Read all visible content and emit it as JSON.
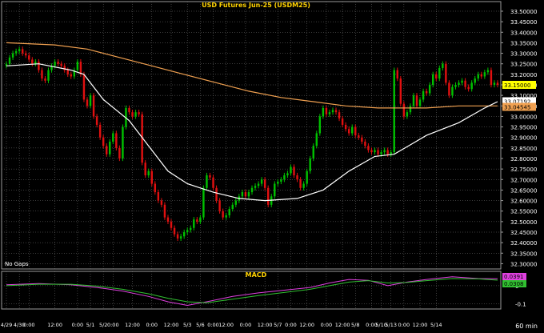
{
  "colors": {
    "background": "#000000",
    "grid": "#7a7a7a",
    "border": "#9a9a9a",
    "title": "#ffd200",
    "text": "#ffffff",
    "candle_up": "#00c000",
    "candle_down": "#e01010",
    "ma_short": "#ffffff",
    "ma_long": "#f0a050",
    "macd_line": "#e040e0",
    "signal_line": "#30c030",
    "last_price_tag": "#ffff00",
    "ma_short_tag": "#ffffff",
    "ma_long_tag": "#f0a050"
  },
  "chart_data": [
    {
      "type": "candlestick",
      "title": "USD Futures Jun-25 (USDM25)",
      "note": "No Gaps",
      "ylim": [
        32.275,
        33.5
      ],
      "y_ticks": [
        "33.50000",
        "33.45000",
        "33.40000",
        "33.35000",
        "33.30000",
        "33.25000",
        "33.20000",
        "33.15000",
        "33.10000",
        "33.05000",
        "33.00000",
        "32.95000",
        "32.90000",
        "32.85000",
        "32.80000",
        "32.75000",
        "32.70000",
        "32.65000",
        "32.60000",
        "32.55000",
        "32.50000",
        "32.45000",
        "32.40000",
        "32.35000",
        "32.30000"
      ],
      "price_tags": {
        "last": "33.15000",
        "ma_short": "33.07192",
        "ma_long": "33.04545"
      },
      "tag_values": {
        "last": 33.15,
        "ma_short": 33.07192,
        "ma_long": 33.04545
      },
      "bar_count": 153,
      "closes": [
        33.25,
        33.28,
        33.3,
        33.31,
        33.32,
        33.3,
        33.29,
        33.27,
        33.25,
        33.26,
        33.22,
        33.18,
        33.17,
        33.22,
        33.24,
        33.26,
        33.25,
        33.24,
        33.22,
        33.2,
        33.19,
        33.22,
        33.26,
        33.2,
        33.08,
        33.05,
        33.1,
        33.0,
        32.96,
        32.9,
        32.86,
        32.82,
        32.88,
        32.92,
        32.85,
        32.8,
        32.95,
        33.04,
        33.02,
        33.0,
        33.02,
        33.01,
        32.78,
        32.72,
        32.74,
        32.68,
        32.64,
        32.6,
        32.58,
        32.52,
        32.5,
        32.47,
        32.44,
        32.42,
        32.43,
        32.45,
        32.46,
        32.47,
        32.51,
        32.5,
        32.52,
        32.66,
        32.72,
        32.71,
        32.66,
        32.6,
        32.55,
        32.52,
        32.53,
        32.56,
        32.58,
        32.6,
        32.62,
        32.64,
        32.62,
        32.64,
        32.66,
        32.67,
        32.68,
        32.7,
        32.66,
        32.58,
        32.62,
        32.68,
        32.69,
        32.7,
        32.72,
        32.73,
        32.76,
        32.72,
        32.7,
        32.66,
        32.68,
        32.74,
        32.8,
        32.86,
        32.92,
        33.0,
        33.04,
        33.01,
        33.02,
        33.03,
        33.02,
        32.99,
        32.96,
        32.94,
        32.92,
        32.95,
        32.91,
        32.9,
        32.88,
        32.86,
        32.84,
        32.83,
        32.84,
        32.82,
        32.83,
        32.84,
        32.82,
        32.83,
        33.22,
        33.18,
        33.06,
        33.0,
        33.02,
        33.05,
        33.1,
        33.05,
        33.08,
        33.12,
        33.11,
        33.15,
        33.2,
        33.18,
        33.23,
        33.25,
        33.16,
        33.1,
        33.14,
        33.15,
        33.16,
        33.17,
        33.14,
        33.13,
        33.16,
        33.18,
        33.2,
        33.19,
        33.21,
        33.22,
        33.15,
        33.16,
        33.15
      ],
      "ma_short_points": [
        [
          0,
          33.24
        ],
        [
          10,
          33.25
        ],
        [
          20,
          33.22
        ],
        [
          24,
          33.2
        ],
        [
          30,
          33.08
        ],
        [
          38,
          32.98
        ],
        [
          44,
          32.86
        ],
        [
          50,
          32.74
        ],
        [
          56,
          32.68
        ],
        [
          64,
          32.64
        ],
        [
          72,
          32.61
        ],
        [
          80,
          32.6
        ],
        [
          90,
          32.61
        ],
        [
          98,
          32.65
        ],
        [
          106,
          32.74
        ],
        [
          114,
          32.81
        ],
        [
          120,
          32.82
        ],
        [
          130,
          32.91
        ],
        [
          140,
          32.97
        ],
        [
          148,
          33.04
        ],
        [
          152,
          33.07
        ]
      ],
      "ma_long_points": [
        [
          0,
          33.35
        ],
        [
          15,
          33.34
        ],
        [
          25,
          33.32
        ],
        [
          35,
          33.28
        ],
        [
          45,
          33.24
        ],
        [
          55,
          33.2
        ],
        [
          65,
          33.16
        ],
        [
          75,
          33.12
        ],
        [
          85,
          33.09
        ],
        [
          95,
          33.07
        ],
        [
          105,
          33.05
        ],
        [
          115,
          33.04
        ],
        [
          122,
          33.04
        ],
        [
          130,
          33.04
        ],
        [
          140,
          33.05
        ],
        [
          152,
          33.05
        ]
      ],
      "x_labels": [
        {
          "i": 0,
          "text": "4/29"
        },
        {
          "i": 4,
          "text": "4/30"
        },
        {
          "i": 7,
          "text": "0:00"
        },
        {
          "i": 15,
          "text": "12:00"
        },
        {
          "i": 22,
          "text": "0:00"
        },
        {
          "i": 26,
          "text": "5/1"
        },
        {
          "i": 30,
          "text": "5/2"
        },
        {
          "i": 33,
          "text": "0:00"
        },
        {
          "i": 39,
          "text": "12:00"
        },
        {
          "i": 45,
          "text": "0:00"
        },
        {
          "i": 51,
          "text": "12:00"
        },
        {
          "i": 56,
          "text": "5/3"
        },
        {
          "i": 60,
          "text": "5/6"
        },
        {
          "i": 64,
          "text": "0:00"
        },
        {
          "i": 68,
          "text": "12:00"
        },
        {
          "i": 74,
          "text": "0:00"
        },
        {
          "i": 80,
          "text": "12:00"
        },
        {
          "i": 84,
          "text": "5/7"
        },
        {
          "i": 88,
          "text": "0:00"
        },
        {
          "i": 93,
          "text": "12:00"
        },
        {
          "i": 99,
          "text": "0:00"
        },
        {
          "i": 104,
          "text": "12:00"
        },
        {
          "i": 108,
          "text": "5/8"
        },
        {
          "i": 113,
          "text": "0:00"
        },
        {
          "i": 116,
          "text": "5/10"
        },
        {
          "i": 119,
          "text": "5/13"
        },
        {
          "i": 123,
          "text": "0:00"
        },
        {
          "i": 128,
          "text": "12:00"
        },
        {
          "i": 133,
          "text": "5/14"
        }
      ]
    },
    {
      "type": "line",
      "title": "MACD",
      "ylim": [
        -0.13,
        0.08
      ],
      "y_ticks": [
        {
          "v": 0.0,
          "text": "0"
        },
        {
          "v": -0.1,
          "text": "-0.1"
        }
      ],
      "value_tags": {
        "macd": "0.0391",
        "signal": "0.0308"
      },
      "tag_values": {
        "macd": 0.0391,
        "signal": 0.0308
      },
      "interval_label": "60 min",
      "series": [
        {
          "name": "",
          "points": [
            [
              0,
              0.005
            ],
            [
              10,
              0.012
            ],
            [
              20,
              0.005
            ],
            [
              28,
              -0.01
            ],
            [
              36,
              -0.03
            ],
            [
              44,
              -0.06
            ],
            [
              50,
              -0.09
            ],
            [
              56,
              -0.11
            ],
            [
              62,
              -0.09
            ],
            [
              70,
              -0.06
            ],
            [
              78,
              -0.04
            ],
            [
              86,
              -0.025
            ],
            [
              94,
              -0.01
            ],
            [
              100,
              0.015
            ],
            [
              106,
              0.035
            ],
            [
              112,
              0.03
            ],
            [
              118,
              0.0
            ],
            [
              124,
              0.02
            ],
            [
              130,
              0.035
            ],
            [
              138,
              0.05
            ],
            [
              146,
              0.04
            ],
            [
              152,
              0.039
            ]
          ]
        },
        {
          "name": "",
          "points": [
            [
              0,
              0.0
            ],
            [
              10,
              0.008
            ],
            [
              20,
              0.008
            ],
            [
              28,
              -0.002
            ],
            [
              36,
              -0.02
            ],
            [
              44,
              -0.045
            ],
            [
              50,
              -0.07
            ],
            [
              56,
              -0.09
            ],
            [
              62,
              -0.095
            ],
            [
              70,
              -0.075
            ],
            [
              78,
              -0.055
            ],
            [
              86,
              -0.038
            ],
            [
              94,
              -0.02
            ],
            [
              100,
              0.0
            ],
            [
              106,
              0.02
            ],
            [
              112,
              0.028
            ],
            [
              118,
              0.015
            ],
            [
              124,
              0.018
            ],
            [
              130,
              0.028
            ],
            [
              138,
              0.04
            ],
            [
              146,
              0.038
            ],
            [
              152,
              0.031
            ]
          ]
        }
      ]
    }
  ]
}
